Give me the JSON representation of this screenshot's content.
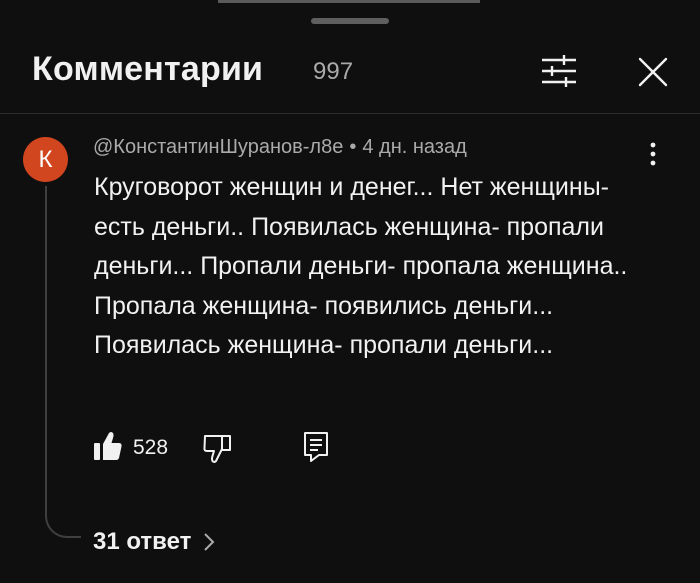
{
  "header": {
    "title": "Комментарии",
    "count": "997"
  },
  "comment": {
    "avatar_letter": "К",
    "avatar_color": "#d1461f",
    "author": "@КонстантинШуранов-л8е",
    "separator": "•",
    "time": "4 дн. назад",
    "text": "Круговорот женщин и денег... Нет женщины- есть деньги.. Появилась женщина- пропали деньги... Пропали деньги- пропала женщина.. Пропала женщина- появились деньги... Появилась женщина- пропали деньги...",
    "likes": "528"
  },
  "replies": {
    "label": "31 ответ"
  },
  "icons": {
    "filter": "filter-sliders-icon",
    "close": "close-icon",
    "more": "more-vertical-icon",
    "like": "thumb-up-icon",
    "dislike": "thumb-down-icon",
    "reply": "reply-comment-icon",
    "chevron": "chevron-right-icon"
  }
}
